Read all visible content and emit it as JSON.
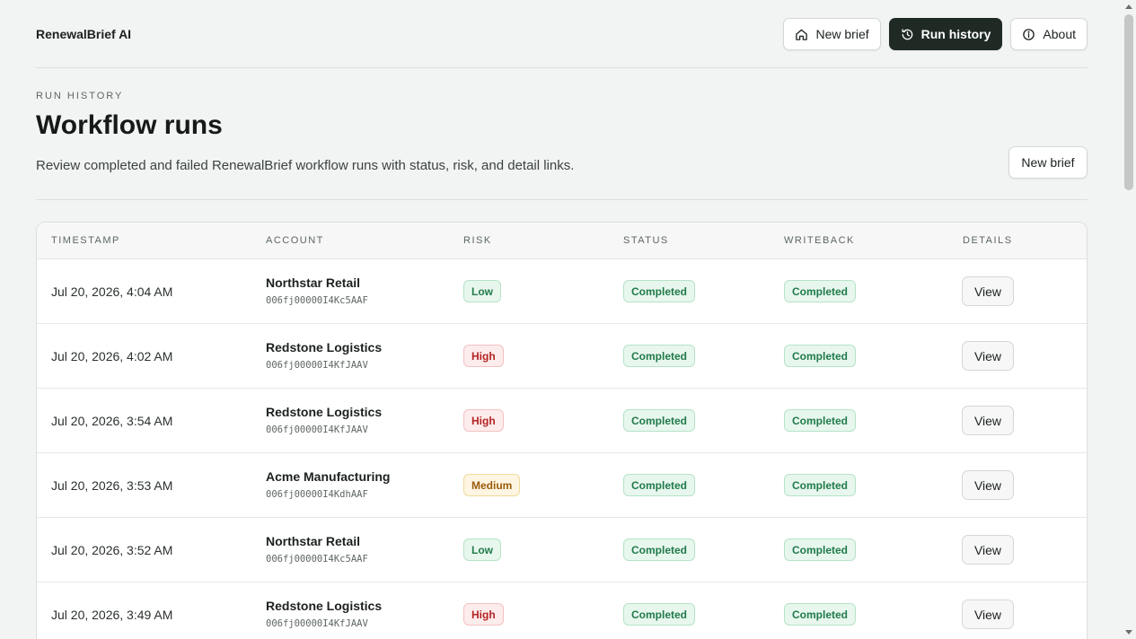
{
  "app": {
    "brand": "RenewalBrief AI"
  },
  "nav": {
    "new_brief": "New brief",
    "run_history": "Run history",
    "about": "About"
  },
  "page": {
    "eyebrow": "RUN HISTORY",
    "title": "Workflow runs",
    "subtitle": "Review completed and failed RenewalBrief workflow runs with status, risk, and detail links.",
    "new_brief_button": "New brief"
  },
  "table": {
    "headers": [
      "TIMESTAMP",
      "ACCOUNT",
      "RISK",
      "STATUS",
      "WRITEBACK",
      "DETAILS"
    ],
    "rows": [
      {
        "timestamp": "Jul 20, 2026, 4:04 AM",
        "account": "Northstar Retail",
        "account_id": "006fj00000I4Kc5AAF",
        "risk": "Low",
        "status": "Completed",
        "writeback": "Completed",
        "details": "View"
      },
      {
        "timestamp": "Jul 20, 2026, 4:02 AM",
        "account": "Redstone Logistics",
        "account_id": "006fj00000I4KfJAAV",
        "risk": "High",
        "status": "Completed",
        "writeback": "Completed",
        "details": "View"
      },
      {
        "timestamp": "Jul 20, 2026, 3:54 AM",
        "account": "Redstone Logistics",
        "account_id": "006fj00000I4KfJAAV",
        "risk": "High",
        "status": "Completed",
        "writeback": "Completed",
        "details": "View"
      },
      {
        "timestamp": "Jul 20, 2026, 3:53 AM",
        "account": "Acme Manufacturing",
        "account_id": "006fj00000I4KdhAAF",
        "risk": "Medium",
        "status": "Completed",
        "writeback": "Completed",
        "details": "View"
      },
      {
        "timestamp": "Jul 20, 2026, 3:52 AM",
        "account": "Northstar Retail",
        "account_id": "006fj00000I4Kc5AAF",
        "risk": "Low",
        "status": "Completed",
        "writeback": "Completed",
        "details": "View"
      },
      {
        "timestamp": "Jul 20, 2026, 3:49 AM",
        "account": "Redstone Logistics",
        "account_id": "006fj00000I4KfJAAV",
        "risk": "High",
        "status": "Completed",
        "writeback": "Completed",
        "details": "View"
      }
    ]
  },
  "colors": {
    "primary_dark": "#1f2a25",
    "risk_low": "#207a4a",
    "risk_high": "#b42323",
    "risk_medium": "#9a5b0b"
  },
  "icons": {
    "new_brief": "home-icon",
    "run_history": "history-icon",
    "about": "info-icon"
  }
}
